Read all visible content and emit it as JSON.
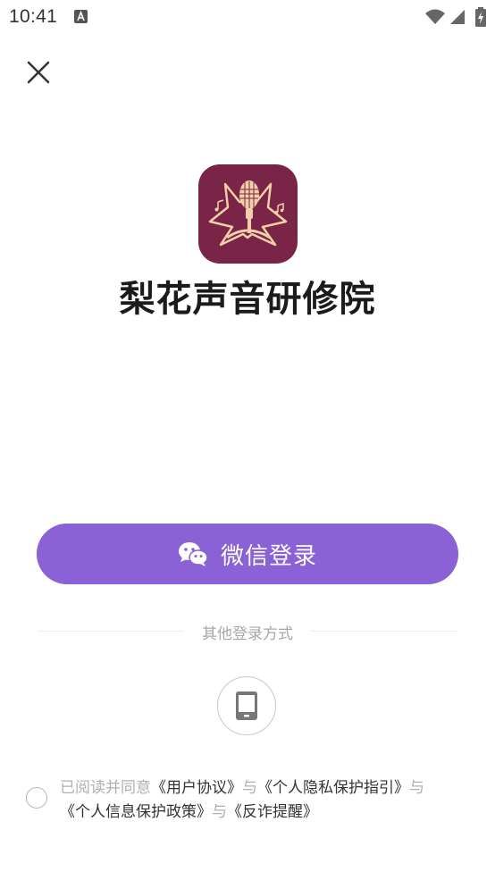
{
  "status_bar": {
    "time": "10:41"
  },
  "header": {
    "close_icon": "close-icon"
  },
  "brand": {
    "app_name": "梨花声音研修院",
    "logo_colors": {
      "background": "#7a2447",
      "accent": "#f2cfa8"
    }
  },
  "login": {
    "wechat_button_label": "微信登录",
    "wechat_icon": "wechat-icon",
    "other_methods_label": "其他登录方式",
    "phone_icon": "phone-icon",
    "button_color": "#8a62d6"
  },
  "agreement": {
    "prefix": "已阅读并同意",
    "user_agreement": "《用户协议》",
    "and_1": "与",
    "privacy_guide": "《个人隐私保护指引》",
    "and_2": "与",
    "info_policy": "《个人信息保护政策》",
    "and_3": "与",
    "anti_fraud": "《反诈提醒》"
  }
}
